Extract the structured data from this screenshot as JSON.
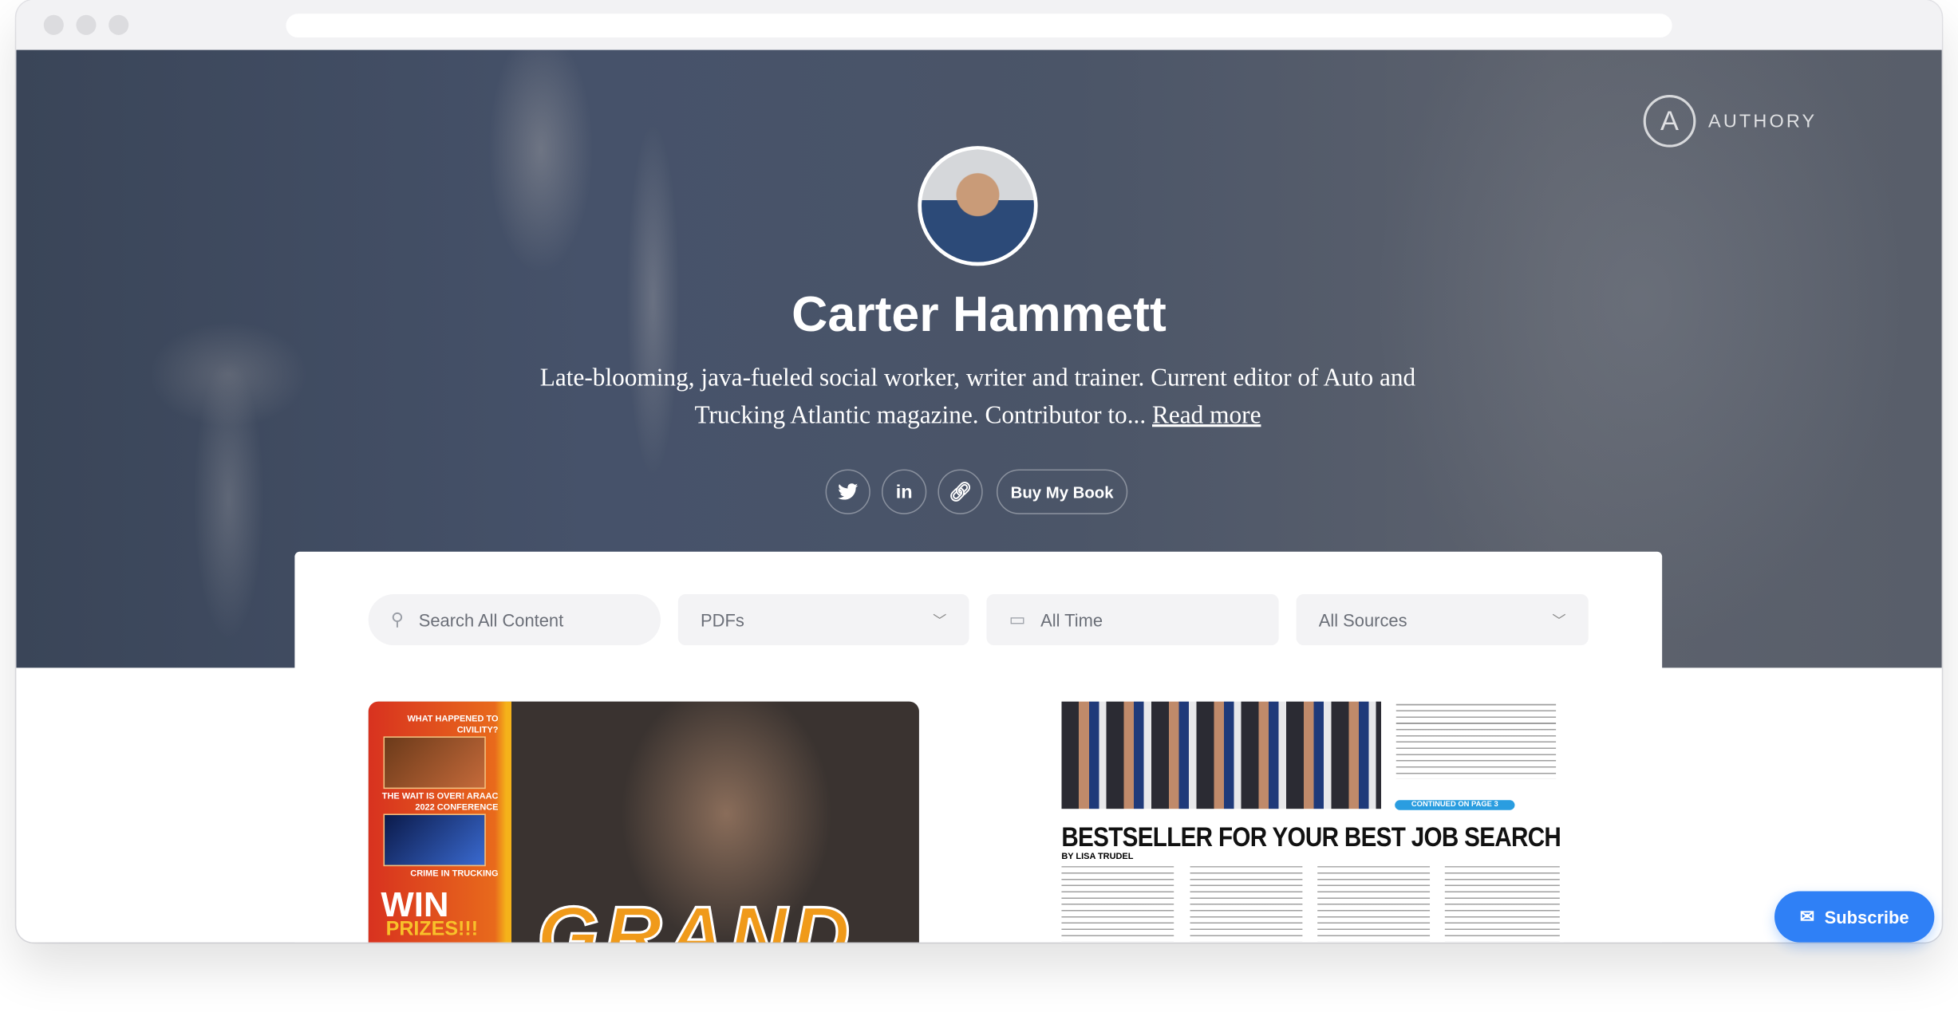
{
  "browser": {
    "url": ""
  },
  "brand": {
    "name": "AUTHORY"
  },
  "profile": {
    "name": "Carter Hammett",
    "bio": "Late-blooming, java-fueled social worker, writer and trainer. Current editor of Auto and Trucking Atlantic magazine. Contributor to...",
    "read_more": "Read more"
  },
  "social": {
    "twitter": "twitter-icon",
    "linkedin": "in",
    "link": "link-icon",
    "book_label": "Buy My Book"
  },
  "filters": {
    "search_placeholder": "Search All Content",
    "type": "PDFs",
    "time": "All Time",
    "sources": "All Sources"
  },
  "items": [
    {
      "cover_lines": [
        "WHAT HAPPENED TO CIVILITY?",
        "THE WAIT IS OVER! ARAAC 2022 CONFERENCE",
        "CRIME IN TRUCKING"
      ],
      "win": "WIN",
      "prizes": "PRIZES!!!",
      "title": "GRAND"
    },
    {
      "continued": "CONTINUED ON PAGE 3",
      "headline": "BESTSELLER FOR YOUR BEST JOB SEARCH",
      "byline": "BY LISA TRUDEL"
    }
  ],
  "subscribe": {
    "label": "Subscribe"
  },
  "colors": {
    "accent": "#2f80f6",
    "filter_bg": "#f3f3f5"
  }
}
